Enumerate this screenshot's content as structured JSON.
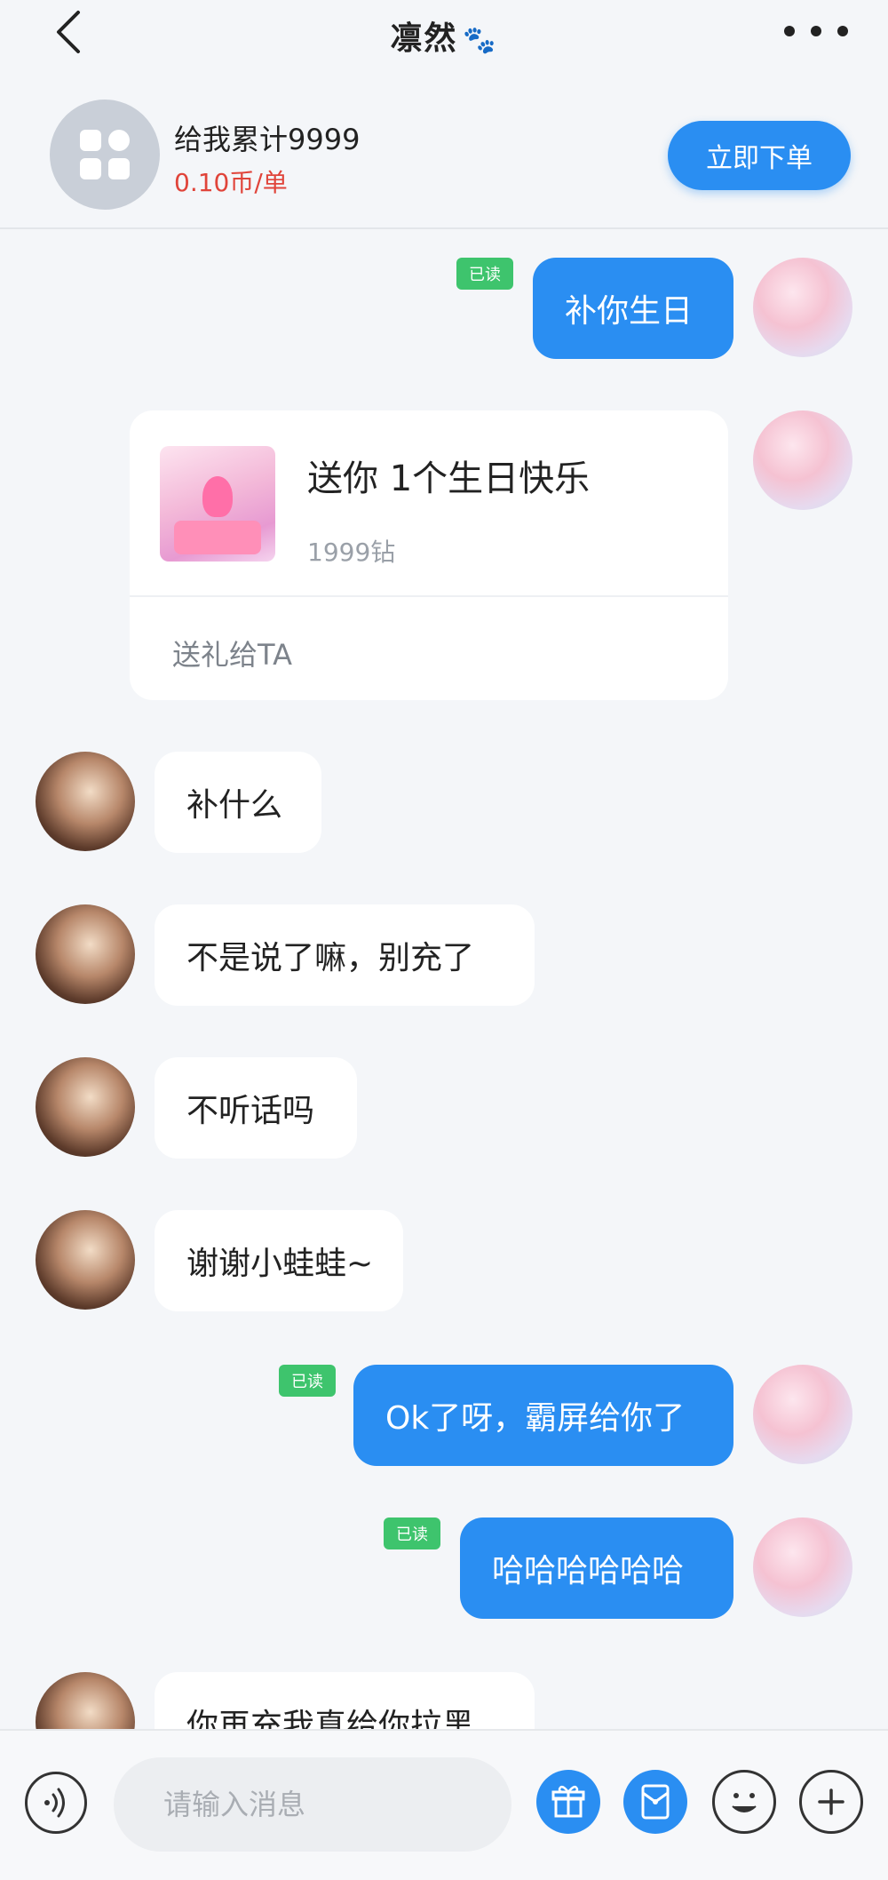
{
  "header": {
    "title": "凛然",
    "title_decoration": "🐾"
  },
  "order": {
    "service_name": "给我累计9999",
    "price": "0.10币/单",
    "order_button": "立即下单"
  },
  "messages": [
    {
      "text": "补你生日",
      "read": "已读"
    },
    {
      "gift_title": "送你 1个生日快乐",
      "gift_price": "1999钻",
      "gift_action": "送礼给TA"
    },
    {
      "text": "补什么"
    },
    {
      "text": "不是说了嘛，别充了"
    },
    {
      "text": "不听话吗"
    },
    {
      "text": "谢谢小蛙蛙~"
    },
    {
      "text": "Ok了呀，霸屏给你了",
      "read": "已读"
    },
    {
      "text": "哈哈哈哈哈哈",
      "read": "已读"
    },
    {
      "text": "你再充我真给你拉黑"
    }
  ],
  "input": {
    "placeholder": "请输入消息"
  },
  "colors": {
    "accent": "#2a8ef2",
    "read_badge": "#3ec46d",
    "price": "#e0443a",
    "background": "#f4f6f9"
  },
  "icons": [
    "back-icon",
    "more-icon",
    "apps-grid-icon",
    "voice-icon",
    "gift-icon",
    "red-packet-icon",
    "emoji-icon",
    "plus-icon"
  ]
}
